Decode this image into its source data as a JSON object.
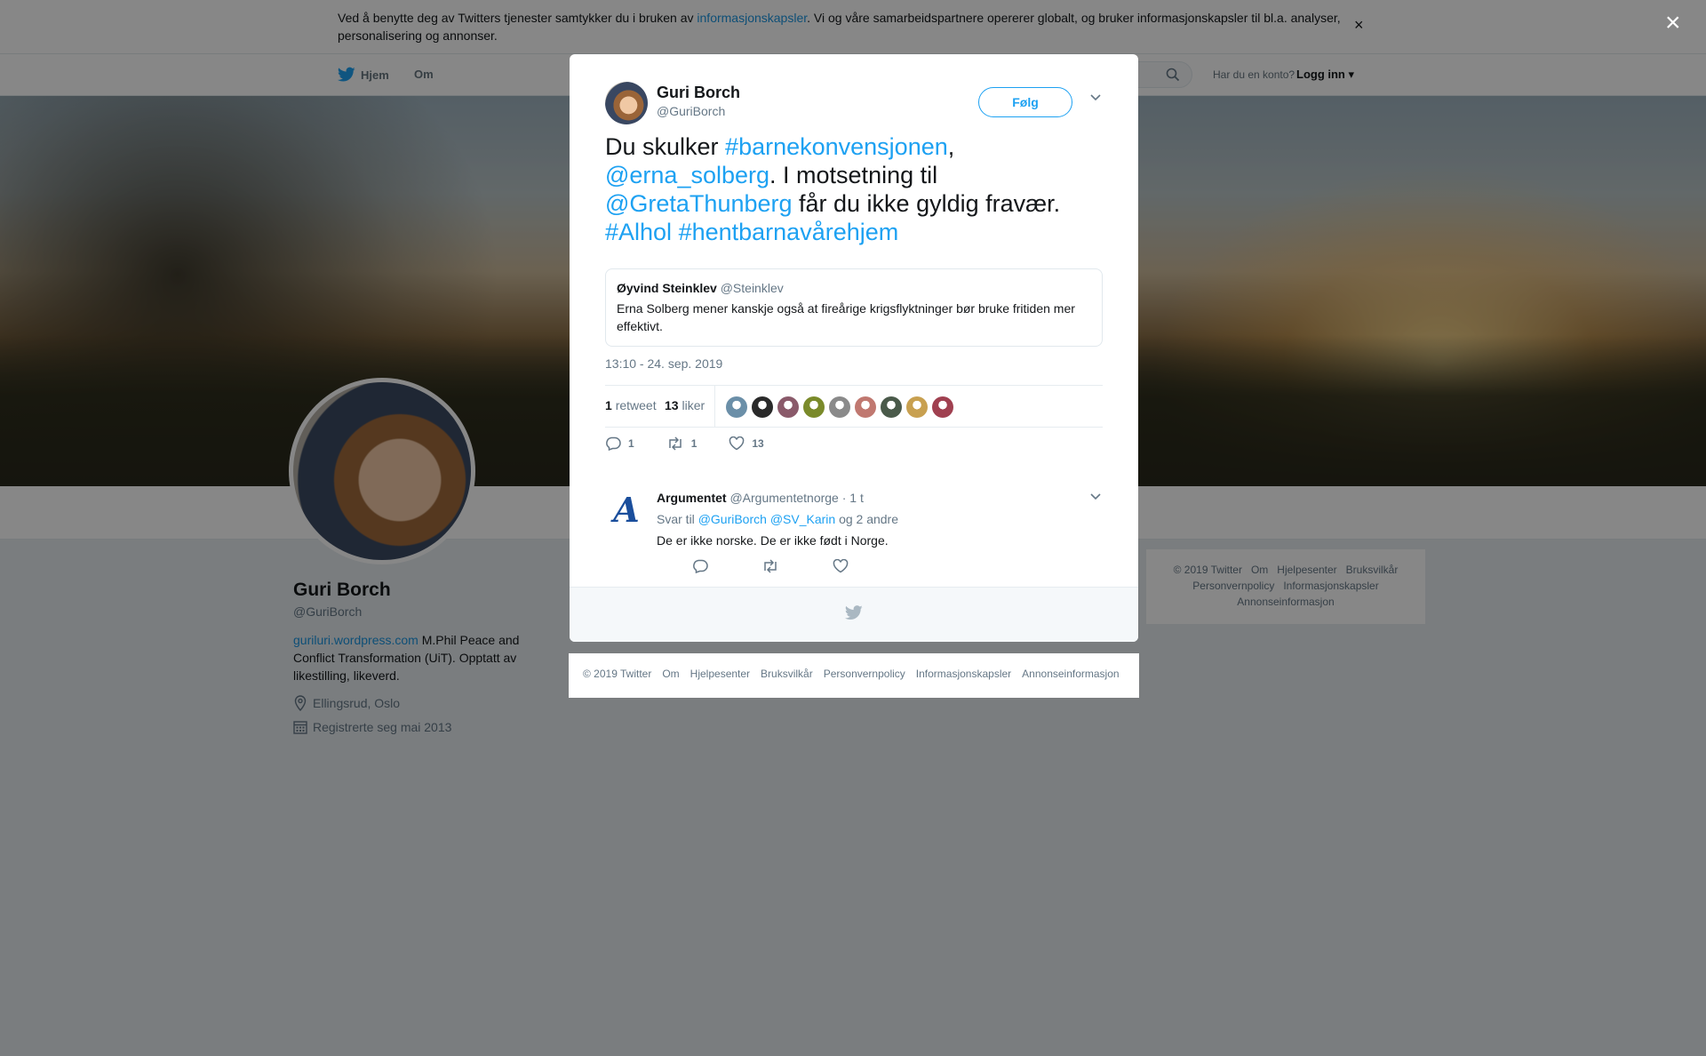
{
  "cookie": {
    "text_before": "Ved å benytte deg av Twitters tjenester samtykker du i bruken av ",
    "link": "informasjonskapsler",
    "text_after": ". Vi og våre samarbeidspartnere opererer globalt, og bruker informasjonskapsler til bl.a. analyser, personalisering og annonser.",
    "close": "×"
  },
  "nav": {
    "home": "Hjem",
    "about": "Om",
    "account_question": "Har du en konto?",
    "login": "Logg inn"
  },
  "profile": {
    "name": "Guri Borch",
    "handle": "@GuriBorch",
    "bio_link": "guriluri.wordpress.com",
    "bio_text": " M.Phil Peace and Conflict Transformation (UiT). Opptatt av likestilling, likeverd.",
    "location": "Ellingsrud, Oslo",
    "joined": "Registrerte seg mai 2013"
  },
  "side_footer": {
    "line1": [
      "© 2019 Twitter",
      "Om",
      "Hjelpesenter",
      "Bruksvilkår"
    ],
    "line2": [
      "Personvernpolicy",
      "Informasjonskapsler"
    ],
    "line3": [
      "Annonseinformasjon"
    ]
  },
  "overlay": {
    "close": "×"
  },
  "tweet": {
    "author_name": "Guri Borch",
    "author_handle": "@GuriBorch",
    "follow_label": "Følg",
    "text": {
      "p1": "Du skulker ",
      "tag1": "#barnekonvensjonen",
      "p2": ", ",
      "mention1": "@erna_solberg",
      "p3": ". I motsetning til ",
      "mention2": "@GretaThunberg",
      "p4": " får du ikke gyldig fravær. ",
      "tag2": "#Alhol",
      "p5": " ",
      "tag3": "#hentbarnavårehjem"
    },
    "quote": {
      "name": "Øyvind Steinklev",
      "handle": "@Steinklev",
      "text": "Erna Solberg mener kanskje også at fireårige krigsflyktninger bør bruke fritiden mer effektivt."
    },
    "timestamp": "13:10 - 24. sep. 2019",
    "retweets_count": "1",
    "retweets_label": "retweet",
    "likes_count": "13",
    "likes_label": "liker",
    "action_replies": "1",
    "action_retweets": "1",
    "action_likes": "13",
    "liker_colors": [
      "#6b8fa8",
      "#2a2a2a",
      "#8a5a6a",
      "#7a8a2a",
      "#8a8a8a",
      "#c07870",
      "#4a5a4a",
      "#c8a050",
      "#a04050"
    ]
  },
  "reply": {
    "name": "Argumentet",
    "handle": "@Argumentetnorge",
    "time": "· 1 t",
    "reply_to_label": "Svar til",
    "reply_to_1": "@GuriBorch",
    "reply_to_2": "@SV_Karin",
    "reply_to_rest": "og 2 andre",
    "text": "De er ikke norske. De er ikke født i Norge.",
    "logo_letter": "A"
  },
  "bottom_links": [
    "© 2019 Twitter",
    "Om",
    "Hjelpesenter",
    "Bruksvilkår",
    "Personvernpolicy",
    "Informasjonskapsler",
    "Annonseinformasjon"
  ],
  "colors": {
    "accent": "#1da1f2",
    "link": "#1b95e0",
    "muted": "#657786"
  }
}
